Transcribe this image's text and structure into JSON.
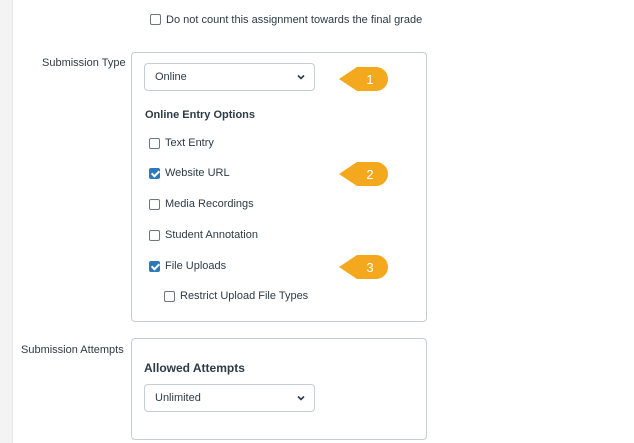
{
  "grade": {
    "exclude_label": "Do not count this assignment towards the final grade",
    "exclude_checked": false
  },
  "submission_type": {
    "label": "Submission Type",
    "selected": "Online",
    "options_heading": "Online Entry Options",
    "options": [
      {
        "label": "Text Entry",
        "checked": false
      },
      {
        "label": "Website URL",
        "checked": true
      },
      {
        "label": "Media Recordings",
        "checked": false
      },
      {
        "label": "Student Annotation",
        "checked": false
      },
      {
        "label": "File Uploads",
        "checked": true
      }
    ],
    "restrict_label": "Restrict Upload File Types",
    "restrict_checked": false
  },
  "submission_attempts": {
    "label": "Submission Attempts",
    "heading": "Allowed Attempts",
    "selected": "Unlimited"
  },
  "callouts": [
    "1",
    "2",
    "3"
  ],
  "colors": {
    "callout": "#f4a81d",
    "checkbox_checked": "#2b7abc",
    "border": "#c7cdd1",
    "text": "#2d3b45"
  }
}
